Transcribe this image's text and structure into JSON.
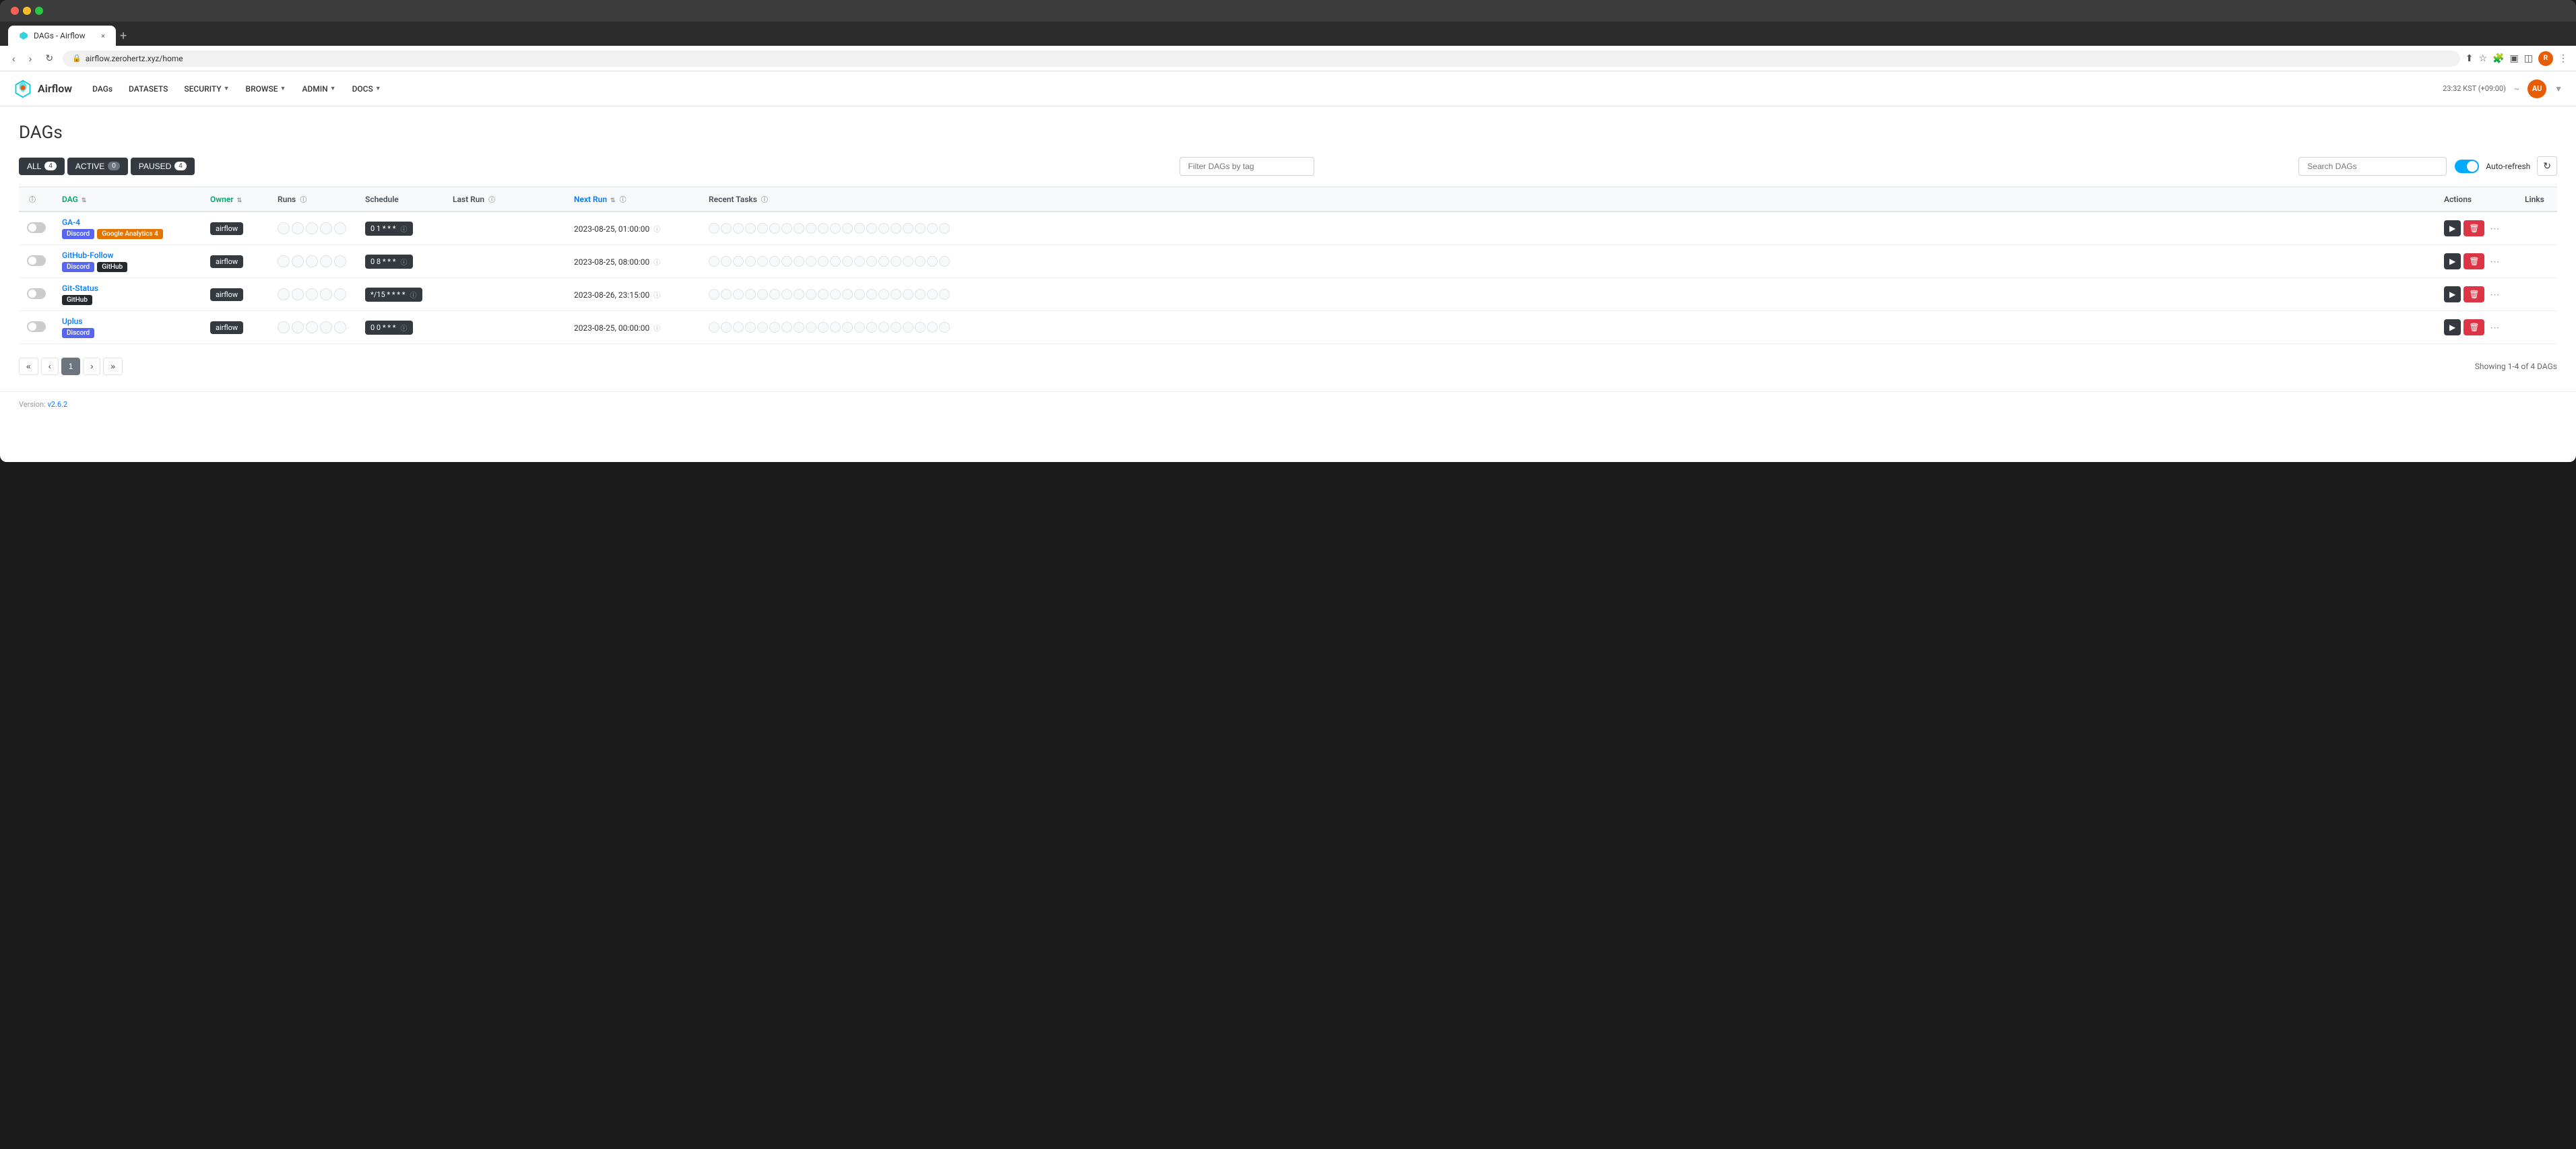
{
  "browser": {
    "tab_title": "DAGs - Airflow",
    "tab_close": "×",
    "new_tab": "+",
    "url": "airflow.zerohertz.xyz/home",
    "nav_back": "‹",
    "nav_forward": "›",
    "nav_reload": "↻",
    "more_options": "⋮",
    "extensions_icon": "⋯"
  },
  "navbar": {
    "brand": "Airflow",
    "links": [
      {
        "label": "DAGs",
        "has_dropdown": false
      },
      {
        "label": "DATASETS",
        "has_dropdown": false
      },
      {
        "label": "SECURITY",
        "has_dropdown": true
      },
      {
        "label": "BROWSE",
        "has_dropdown": true
      },
      {
        "label": "ADMIN",
        "has_dropdown": true
      },
      {
        "label": "DOCS",
        "has_dropdown": true
      }
    ],
    "timezone": "23:32 KST (+09:00)",
    "user_initials": "AU"
  },
  "page": {
    "title": "DAGs",
    "filter_tabs": [
      {
        "label": "ALL",
        "count": "4",
        "active": true
      },
      {
        "label": "ACTIVE",
        "count": "0",
        "active": false
      },
      {
        "label": "PAUSED",
        "count": "4",
        "active": false
      }
    ],
    "tag_filter_placeholder": "Filter DAGs by tag",
    "search_placeholder": "Search DAGs",
    "auto_refresh_label": "Auto-refresh",
    "refresh_icon": "↻"
  },
  "table": {
    "headers": [
      {
        "label": "DAG",
        "sortable": true,
        "color": "green"
      },
      {
        "label": "Owner",
        "sortable": true,
        "color": "green"
      },
      {
        "label": "Runs",
        "info": true
      },
      {
        "label": "Schedule"
      },
      {
        "label": "Last Run",
        "info": true
      },
      {
        "label": "Next Run",
        "sortable": true,
        "info": true,
        "color": "blue"
      },
      {
        "label": "Recent Tasks",
        "info": true
      },
      {
        "label": "Actions"
      },
      {
        "label": "Links"
      }
    ],
    "rows": [
      {
        "id": "GA-4",
        "name": "GA-4",
        "tags": [
          {
            "label": "Discord",
            "class": "tag-discord"
          },
          {
            "label": "Google Analytics 4",
            "class": "tag-ga4"
          }
        ],
        "owner": "airflow",
        "runs_count": 5,
        "schedule": "0 1 * * *",
        "last_run": "",
        "next_run": "2023-08-25, 01:00:00",
        "recent_tasks_count": 20,
        "enabled": false
      },
      {
        "id": "GitHub-Follow",
        "name": "GitHub-Follow",
        "tags": [
          {
            "label": "Discord",
            "class": "tag-discord"
          },
          {
            "label": "GitHub",
            "class": "tag-github"
          }
        ],
        "owner": "airflow",
        "runs_count": 5,
        "schedule": "0 8 * * *",
        "last_run": "",
        "next_run": "2023-08-25, 08:00:00",
        "recent_tasks_count": 20,
        "enabled": false
      },
      {
        "id": "Git-Status",
        "name": "Git-Status",
        "tags": [
          {
            "label": "GitHub",
            "class": "tag-github"
          }
        ],
        "owner": "airflow",
        "runs_count": 5,
        "schedule": "*/15 * * * *",
        "last_run": "",
        "next_run": "2023-08-26, 23:15:00",
        "recent_tasks_count": 20,
        "enabled": false
      },
      {
        "id": "Uplus",
        "name": "Uplus",
        "tags": [
          {
            "label": "Discord",
            "class": "tag-discord"
          }
        ],
        "owner": "airflow",
        "runs_count": 5,
        "schedule": "0 0 * * *",
        "last_run": "",
        "next_run": "2023-08-25, 00:00:00",
        "recent_tasks_count": 20,
        "enabled": false
      }
    ]
  },
  "pagination": {
    "prev_prev": "«",
    "prev": "‹",
    "current": "1",
    "next": "›",
    "next_next": "»",
    "showing_text": "Showing 1-4 of 4 DAGs"
  },
  "footer": {
    "version_label": "Version:",
    "version_number": "v2.6.2"
  }
}
